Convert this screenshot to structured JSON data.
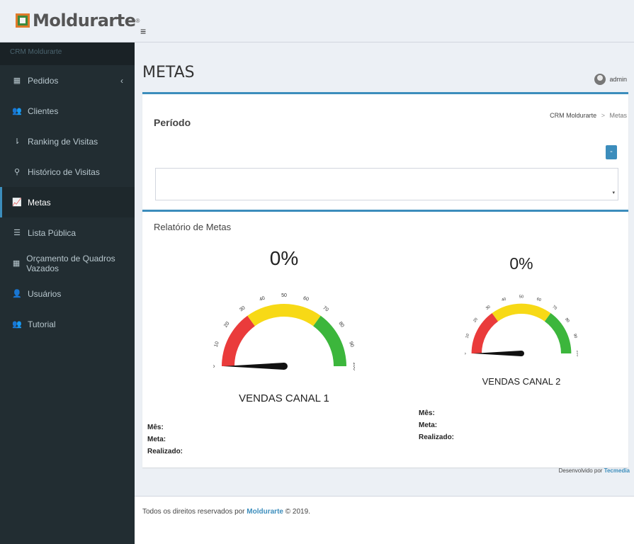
{
  "brand": {
    "name": "Moldurarte",
    "reg": "®"
  },
  "header": {
    "menu_icon": "≡"
  },
  "sidebar": {
    "header": "CRM Moldurarte",
    "items": [
      {
        "label": "Pedidos",
        "icon": "th-icon"
      },
      {
        "label": "Clientes",
        "icon": "users-icon"
      },
      {
        "label": "Ranking de Visitas",
        "icon": "sort-icon"
      },
      {
        "label": "Histórico de Visitas",
        "icon": "map-marker-icon"
      },
      {
        "label": "Metas",
        "icon": "line-chart-icon",
        "active": true
      },
      {
        "label": "Lista Pública",
        "icon": "list-icon"
      },
      {
        "label": "Orçamento de Quadros Vazados",
        "icon": "th-icon"
      },
      {
        "label": "Usuários",
        "icon": "user-icon"
      },
      {
        "label": "Tutorial",
        "icon": "users-icon"
      }
    ],
    "caret": "‹"
  },
  "page": {
    "title": "METAS",
    "user": "admin",
    "breadcrumb": {
      "root": "CRM Moldurarte",
      "sep": ">",
      "current": "Metas"
    }
  },
  "periodo": {
    "title": "Período",
    "collapse": "-",
    "arrow": "▾"
  },
  "metas": {
    "title": "Relatório de Metas",
    "gauges": [
      {
        "percent": "0%",
        "label": "VENDAS CANAL 1",
        "value": 0
      },
      {
        "percent": "0%",
        "label": "VENDAS CANAL 2",
        "value": 0
      }
    ],
    "ticks": [
      "0",
      "10",
      "20",
      "30",
      "40",
      "50",
      "60",
      "70",
      "80",
      "90",
      "100"
    ],
    "stats": {
      "mes": "Mês:",
      "meta": "Meta:",
      "realizado": "Realizado:"
    },
    "colors": {
      "red": "#ea3b3b",
      "yellow": "#f7d916",
      "green": "#3cb63c"
    }
  },
  "credit": {
    "prefix": "Desenvolvido por ",
    "brand": "Tecmedia"
  },
  "footer": {
    "prefix": "Todos os direitos reservados por ",
    "brand": "Moldurarte",
    "suffix": " © 2019."
  }
}
